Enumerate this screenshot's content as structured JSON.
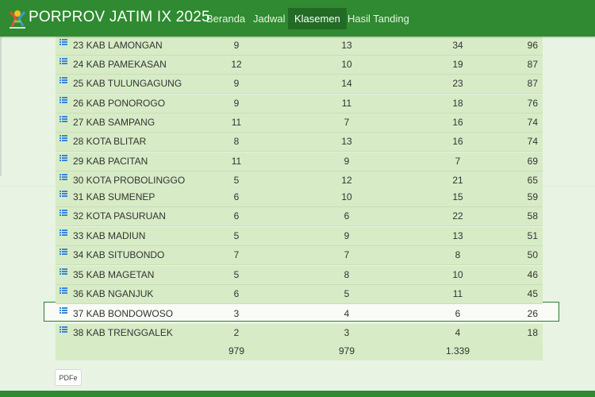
{
  "navbar": {
    "brand": "PORPROV JATIM IX 2025",
    "items": [
      {
        "label": "Beranda",
        "active": false
      },
      {
        "label": "Jadwal",
        "active": false
      },
      {
        "label": "Klasemen",
        "active": true
      },
      {
        "label": "Hasil Tanding",
        "active": false
      }
    ]
  },
  "standings": {
    "rows": [
      {
        "rank": "23",
        "name": "23 KAB LAMONGAN",
        "gold": "9",
        "silver": "13",
        "bronze": "34",
        "total": "96"
      },
      {
        "rank": "24",
        "name": "24 KAB PAMEKASAN",
        "gold": "12",
        "silver": "10",
        "bronze": "19",
        "total": "87"
      },
      {
        "rank": "25",
        "name": "25 KAB TULUNGAGUNG",
        "gold": "9",
        "silver": "14",
        "bronze": "23",
        "total": "87"
      },
      {
        "rank": "26",
        "name": "26 KAB PONOROGO",
        "gold": "9",
        "silver": "11",
        "bronze": "18",
        "total": "76"
      },
      {
        "rank": "27",
        "name": "27 KAB SAMPANG",
        "gold": "11",
        "silver": "7",
        "bronze": "16",
        "total": "74"
      },
      {
        "rank": "28",
        "name": "28 KOTA BLITAR",
        "gold": "8",
        "silver": "13",
        "bronze": "16",
        "total": "74"
      },
      {
        "rank": "29",
        "name": "29 KAB PACITAN",
        "gold": "11",
        "silver": "9",
        "bronze": "7",
        "total": "69"
      },
      {
        "rank": "30",
        "name": "30 KOTA PROBOLINGGO",
        "gold": "5",
        "silver": "12",
        "bronze": "21",
        "total": "65"
      },
      {
        "rank": "31",
        "name": "31 KAB SUMENEP",
        "gold": "6",
        "silver": "10",
        "bronze": "15",
        "total": "59"
      },
      {
        "rank": "32",
        "name": "32 KOTA PASURUAN",
        "gold": "6",
        "silver": "6",
        "bronze": "22",
        "total": "58"
      },
      {
        "rank": "33",
        "name": "33 KAB MADIUN",
        "gold": "5",
        "silver": "9",
        "bronze": "13",
        "total": "51"
      },
      {
        "rank": "34",
        "name": "34 KAB SITUBONDO",
        "gold": "7",
        "silver": "7",
        "bronze": "8",
        "total": "50"
      },
      {
        "rank": "35",
        "name": "35 KAB MAGETAN",
        "gold": "5",
        "silver": "8",
        "bronze": "10",
        "total": "46"
      },
      {
        "rank": "36",
        "name": "36 KAB NGANJUK",
        "gold": "6",
        "silver": "5",
        "bronze": "11",
        "total": "45"
      },
      {
        "rank": "37",
        "name": "37 KAB BONDOWOSO",
        "gold": "3",
        "silver": "4",
        "bronze": "6",
        "total": "26",
        "highlighted": true
      },
      {
        "rank": "38",
        "name": "38 KAB TRENGGALEK",
        "gold": "2",
        "silver": "3",
        "bronze": "4",
        "total": "18"
      }
    ],
    "totals": {
      "gold": "979",
      "silver": "979",
      "bronze": "1.339"
    }
  },
  "buttons": {
    "pdf_label": "PDFe"
  },
  "colors": {
    "navbar": "#2f8a31",
    "active_tab": "#236b25",
    "row_bg": "#d7ecc6",
    "highlight_border": "#2e7d32",
    "icon": "#3a86d8"
  },
  "icons": {
    "row_icon": "list-icon",
    "logo": "porprov-logo-icon"
  }
}
